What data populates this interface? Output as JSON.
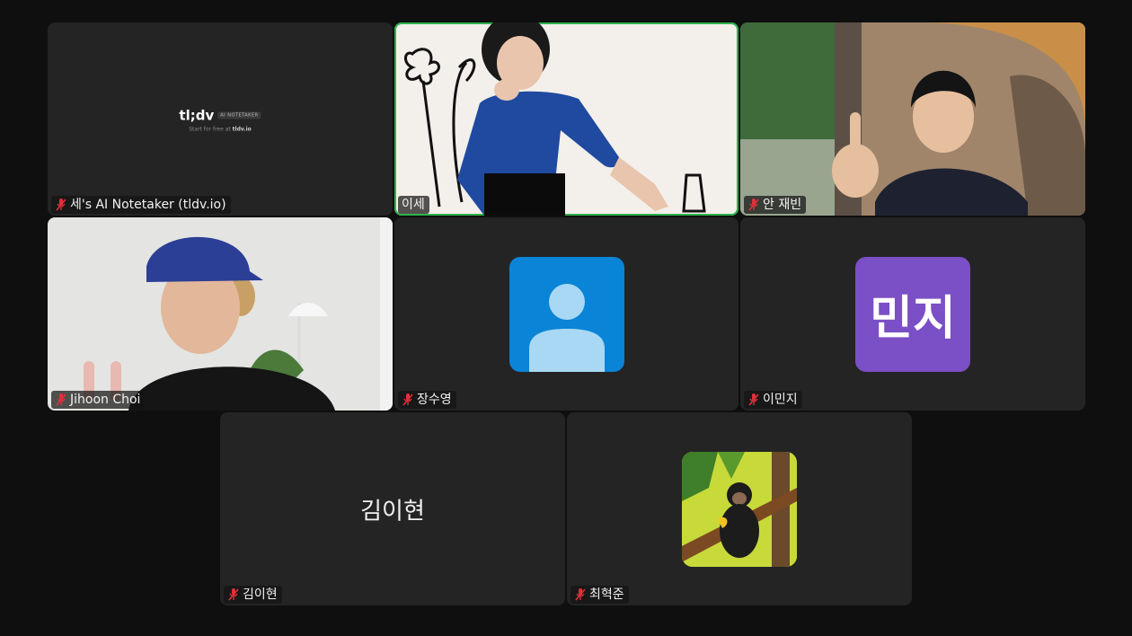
{
  "participants": [
    {
      "name": "세's AI Notetaker (tldv.io)",
      "muted": true
    },
    {
      "name": "이세",
      "muted": false
    },
    {
      "name": "안 재빈",
      "muted": true
    },
    {
      "name": "Jihoon Choi",
      "muted": true
    },
    {
      "name": "장수영",
      "muted": true
    },
    {
      "name": "이민지",
      "muted": true
    },
    {
      "name": "김이현",
      "muted": true
    },
    {
      "name": "최혁준",
      "muted": true
    }
  ],
  "notetaker": {
    "logo": "tl;dv",
    "badge": "AI NOTETAKER",
    "subtitle_prefix": "Start for free at ",
    "subtitle_link": "tldv.io"
  },
  "avatars": {
    "minji_initials": "민지",
    "kim_display_name": "김이현"
  },
  "colors": {
    "active_speaker_border": "#2fb34d",
    "default_avatar_bg": "#0a84d6",
    "minji_avatar_bg": "#7b4fc6",
    "muted_mic": "#e0303a"
  }
}
